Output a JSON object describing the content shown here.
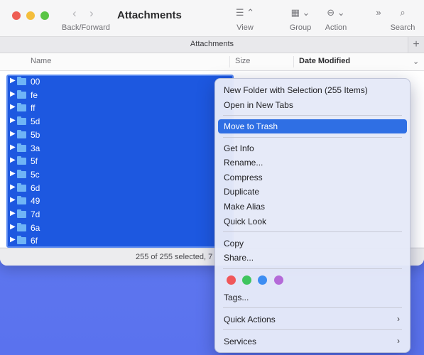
{
  "window": {
    "title": "Attachments",
    "nav_label": "Back/Forward",
    "nav_back": "‹",
    "nav_forward": "›"
  },
  "toolbar": {
    "view_label": "View",
    "group_label": "Group",
    "action_label": "Action",
    "search_label": "Search",
    "view_icon": "☰ ⌃",
    "group_icon": "▦ ⌄",
    "action_icon": "⊖ ⌄",
    "more_icon": "»",
    "search_icon": "⌕"
  },
  "tab": {
    "label": "Attachments",
    "add": "+"
  },
  "columns": {
    "name": "Name",
    "size": "Size",
    "date": "Date Modified"
  },
  "files": [
    "00",
    "fe",
    "ff",
    "5d",
    "5b",
    "3a",
    "5f",
    "5c",
    "6d",
    "49",
    "7d",
    "6a",
    "6f"
  ],
  "status": {
    "text": "255 of 255 selected, 7"
  },
  "context_menu": {
    "group1": [
      "New Folder with Selection (255 Items)",
      "Open in New Tabs"
    ],
    "move_to_trash": "Move to Trash",
    "group2": [
      "Get Info",
      "Rename...",
      "Compress",
      "Duplicate",
      "Make Alias",
      "Quick Look"
    ],
    "group3": [
      "Copy",
      "Share..."
    ],
    "tag_colors": [
      "#f0575a",
      "#3fc55f",
      "#3d8df2",
      "#b46ad8"
    ],
    "tags": "Tags...",
    "quick_actions": "Quick Actions",
    "services": "Services",
    "submenu_chevron": "›"
  }
}
